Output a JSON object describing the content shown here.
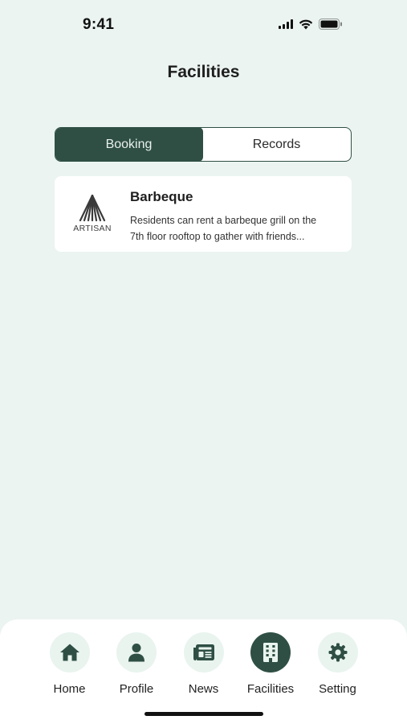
{
  "status_bar": {
    "time": "9:41"
  },
  "header": {
    "title": "Facilities"
  },
  "tabs": [
    {
      "label": "Booking",
      "active": true
    },
    {
      "label": "Records",
      "active": false
    }
  ],
  "facilities": [
    {
      "logo_text": "ARTISAN",
      "title": "Barbeque",
      "description_line1": "Residents can rent a barbeque grill on the",
      "description_line2": "7th floor rooftop to gather with friends..."
    }
  ],
  "nav": {
    "items": [
      {
        "label": "Home",
        "icon": "home-icon"
      },
      {
        "label": "Profile",
        "icon": "person-icon"
      },
      {
        "label": "News",
        "icon": "newspaper-icon"
      },
      {
        "label": "Facilities",
        "icon": "building-icon",
        "active": true
      },
      {
        "label": "Setting",
        "icon": "gear-icon"
      }
    ]
  },
  "colors": {
    "background": "#EBF4F0",
    "primary": "#2F4F44",
    "nav_circle": "#E9F4EF"
  }
}
